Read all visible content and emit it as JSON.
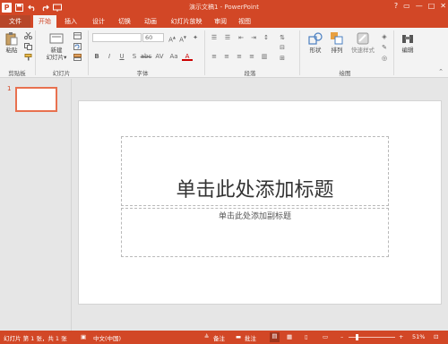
{
  "window": {
    "title": "演示文稿1 - PowerPoint",
    "app_icon_label": "P",
    "controls": [
      "?",
      "▭",
      "—",
      "□",
      "✕"
    ]
  },
  "qat": {
    "save_icon": "save-icon",
    "undo_icon": "undo-icon",
    "redo_icon": "redo-icon",
    "present_icon": "present-icon"
  },
  "tabs": [
    "文件",
    "开始",
    "插入",
    "设计",
    "切换",
    "动画",
    "幻灯片放映",
    "审阅",
    "视图"
  ],
  "active_tab": "开始",
  "ribbon": {
    "clipboard": {
      "paste": "粘贴",
      "label": "剪贴板"
    },
    "slides": {
      "new_slide": "新建\n幻灯片▾",
      "label": "幻灯片"
    },
    "font": {
      "size_value": "60",
      "label": "字体",
      "format_buttons": [
        "B",
        "I",
        "U",
        "S",
        "abc",
        "AV",
        "Aa",
        "A"
      ]
    },
    "paragraph": {
      "label": "段落"
    },
    "drawing": {
      "shape": "形状",
      "arrange": "排列",
      "quick_styles": "快速样式",
      "label": "绘图"
    },
    "editing": {
      "edit": "编辑"
    }
  },
  "thumbnails": [
    {
      "number": "1"
    }
  ],
  "slide": {
    "title_placeholder": "单击此处添加标题",
    "subtitle_placeholder": "单击此处添加副标题"
  },
  "status": {
    "slide_info": "幻灯片 第 1 张，共 1 张",
    "language": "中文(中国)",
    "notes": "备注",
    "comments": "批注",
    "zoom_minus": "–",
    "zoom_plus": "+",
    "zoom_percent": "51%",
    "zoom_level": 0.51
  },
  "colors": {
    "accent": "#d24726",
    "ribbon_bg": "#f3f3f3",
    "workspace": "#e6e6e6"
  }
}
